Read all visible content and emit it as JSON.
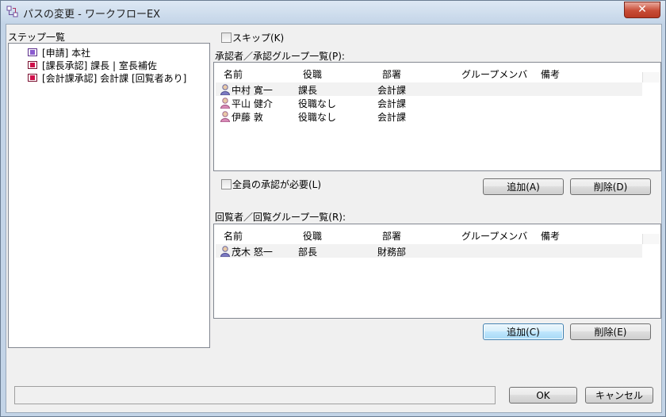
{
  "window": {
    "title": "パスの変更 - ワークフローEX",
    "close_label": "✕"
  },
  "steps": {
    "label": "ステップ一覧",
    "items": [
      {
        "label": "[申請] 本社",
        "kind": "start"
      },
      {
        "label": "[課長承認] 課長 | 室長補佐",
        "kind": "approve"
      },
      {
        "label": "[会計課承認] 会計課 [回覧者あり]",
        "kind": "approve"
      }
    ]
  },
  "skip": {
    "label": "スキップ(K)",
    "checked": false
  },
  "approvers": {
    "label": "承認者／承認グループ一覧(P):",
    "columns": [
      "名前",
      "役職",
      "部署",
      "グループメンバ",
      "備考"
    ],
    "rows": [
      {
        "name": "中村 寛一",
        "title": "課長",
        "dept": "会計課",
        "group": "",
        "note": "",
        "icon": "person-male-icon"
      },
      {
        "name": "平山 健介",
        "title": "役職なし",
        "dept": "会計課",
        "group": "",
        "note": "",
        "icon": "person-female-icon"
      },
      {
        "name": "伊藤 敦",
        "title": "役職なし",
        "dept": "会計課",
        "group": "",
        "note": "",
        "icon": "person-female-icon"
      }
    ],
    "all_required": {
      "label": "全員の承認が必要(L)",
      "checked": false
    },
    "add_label": "追加(A)",
    "delete_label": "削除(D)"
  },
  "viewers": {
    "label": "回覧者／回覧グループ一覧(R):",
    "columns": [
      "名前",
      "役職",
      "部署",
      "グループメンバ",
      "備考"
    ],
    "rows": [
      {
        "name": "茂木 怒一",
        "title": "部長",
        "dept": "財務部",
        "group": "",
        "note": "",
        "icon": "person-male-icon"
      }
    ],
    "add_label": "追加(C)",
    "delete_label": "削除(E)"
  },
  "footer": {
    "status_text": "",
    "ok_label": "OK",
    "cancel_label": "キャンセル"
  },
  "colors": {
    "titlebar": "#c4d5e8",
    "close": "#c84c36",
    "selection": "#f2f2f2",
    "focus_button": "#bee6fd"
  }
}
